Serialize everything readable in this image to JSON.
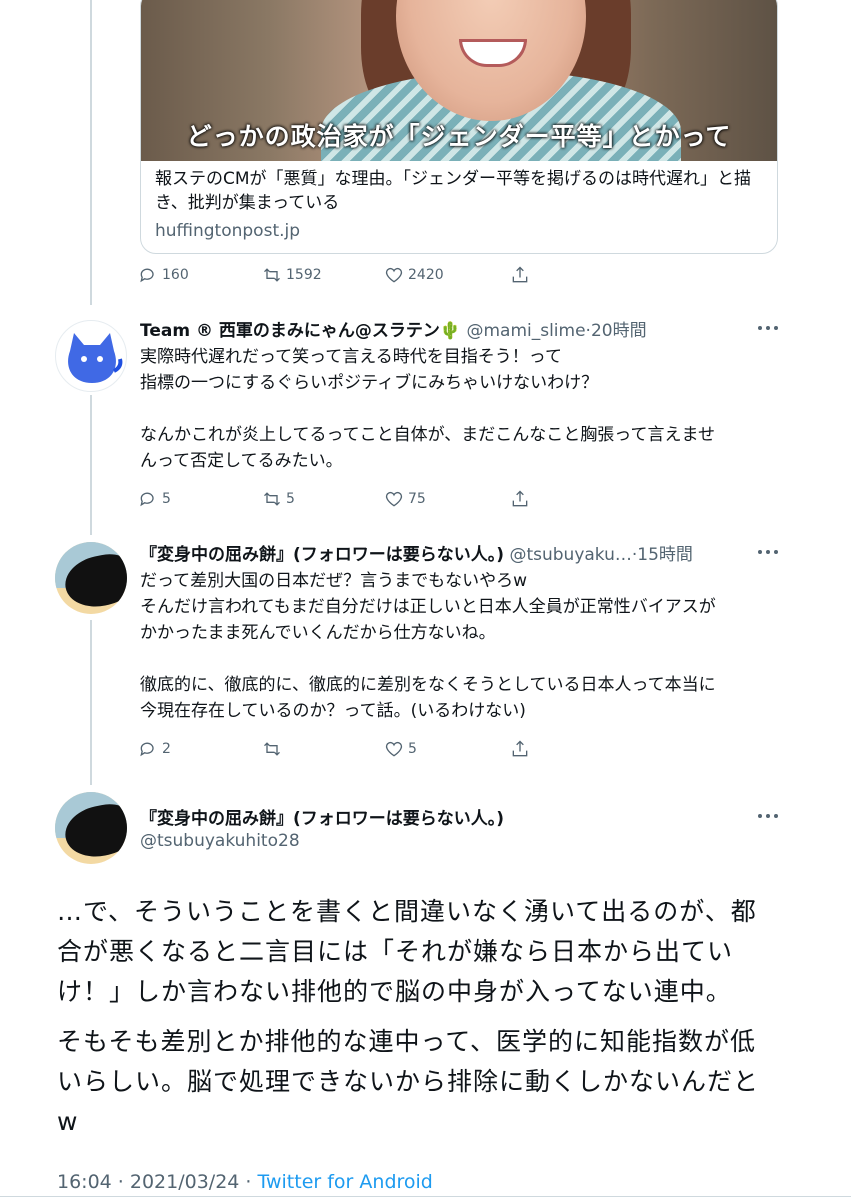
{
  "card": {
    "caption": "どっかの政治家が「ジェンダー平等」とかって",
    "title": "報ステのCMが「悪質」な理由。「ジェンダー平等を掲げるのは時代遅れ」と描き、批判が集まっている",
    "domain": "huffingtonpost.jp"
  },
  "card_actions": {
    "replies": "160",
    "retweets": "1592",
    "likes": "2420"
  },
  "reply1": {
    "name": "Team ® 西軍のまみにゃん@スラテン🌵",
    "meta": "@mami_slime·20時間",
    "lines": [
      "実際時代遅れだって笑って言える時代を目指そう！って",
      "指標の一つにするぐらいポジティブにみちゃいけないわけ？",
      "",
      "なんかこれが炎上してるってこと自体が、まだこんなこと胸張って言えませ",
      "んって否定してるみたい。"
    ],
    "replies": "5",
    "retweets": "5",
    "likes": "75"
  },
  "reply2": {
    "name": "『変身中の屈み餅』(フォロワーは要らない人。)",
    "meta": "@tsubuyaku…·15時間",
    "lines": [
      "だって差別大国の日本だぜ？言うまでもないやろw",
      "そんだけ言われてもまだ自分だけは正しいと日本人全員が正常性バイアスが",
      "かかったまま死んでいくんだから仕方ないね。",
      "",
      "徹底的に、徹底的に、徹底的に差別をなくそうとしている日本人って本当に",
      "今現在存在しているのか？って話。(いるわけない)"
    ],
    "replies": "2",
    "retweets": "",
    "likes": "5"
  },
  "main": {
    "name": "『変身中の屈み餅』(フォロワーは要らない人。)",
    "handle": "@tsubuyakuhito28",
    "para1": [
      "…で、そういうことを書くと間違いなく湧いて出るのが、都",
      "合が悪くなると二言目には「それが嫌なら日本から出てい",
      "け！」しか言わない排他的で脳の中身が入ってない連中。"
    ],
    "para2": [
      "そもそも差別とか排他的な連中って、医学的に知能指数が低",
      "いらしい。脳で処理できないから排除に動くしかないんだと",
      "w"
    ],
    "time": "16:04 · 2021/03/24 · ",
    "source": "Twitter for Android"
  },
  "icons": [
    "reply-icon",
    "retweet-icon",
    "like-icon",
    "share-icon",
    "more-icon"
  ],
  "colors": {
    "text": "#0f1419",
    "muted": "#536471",
    "link": "#1d9bf0",
    "line": "#cfd9de",
    "avatar_cat": "#1f4fe0"
  }
}
